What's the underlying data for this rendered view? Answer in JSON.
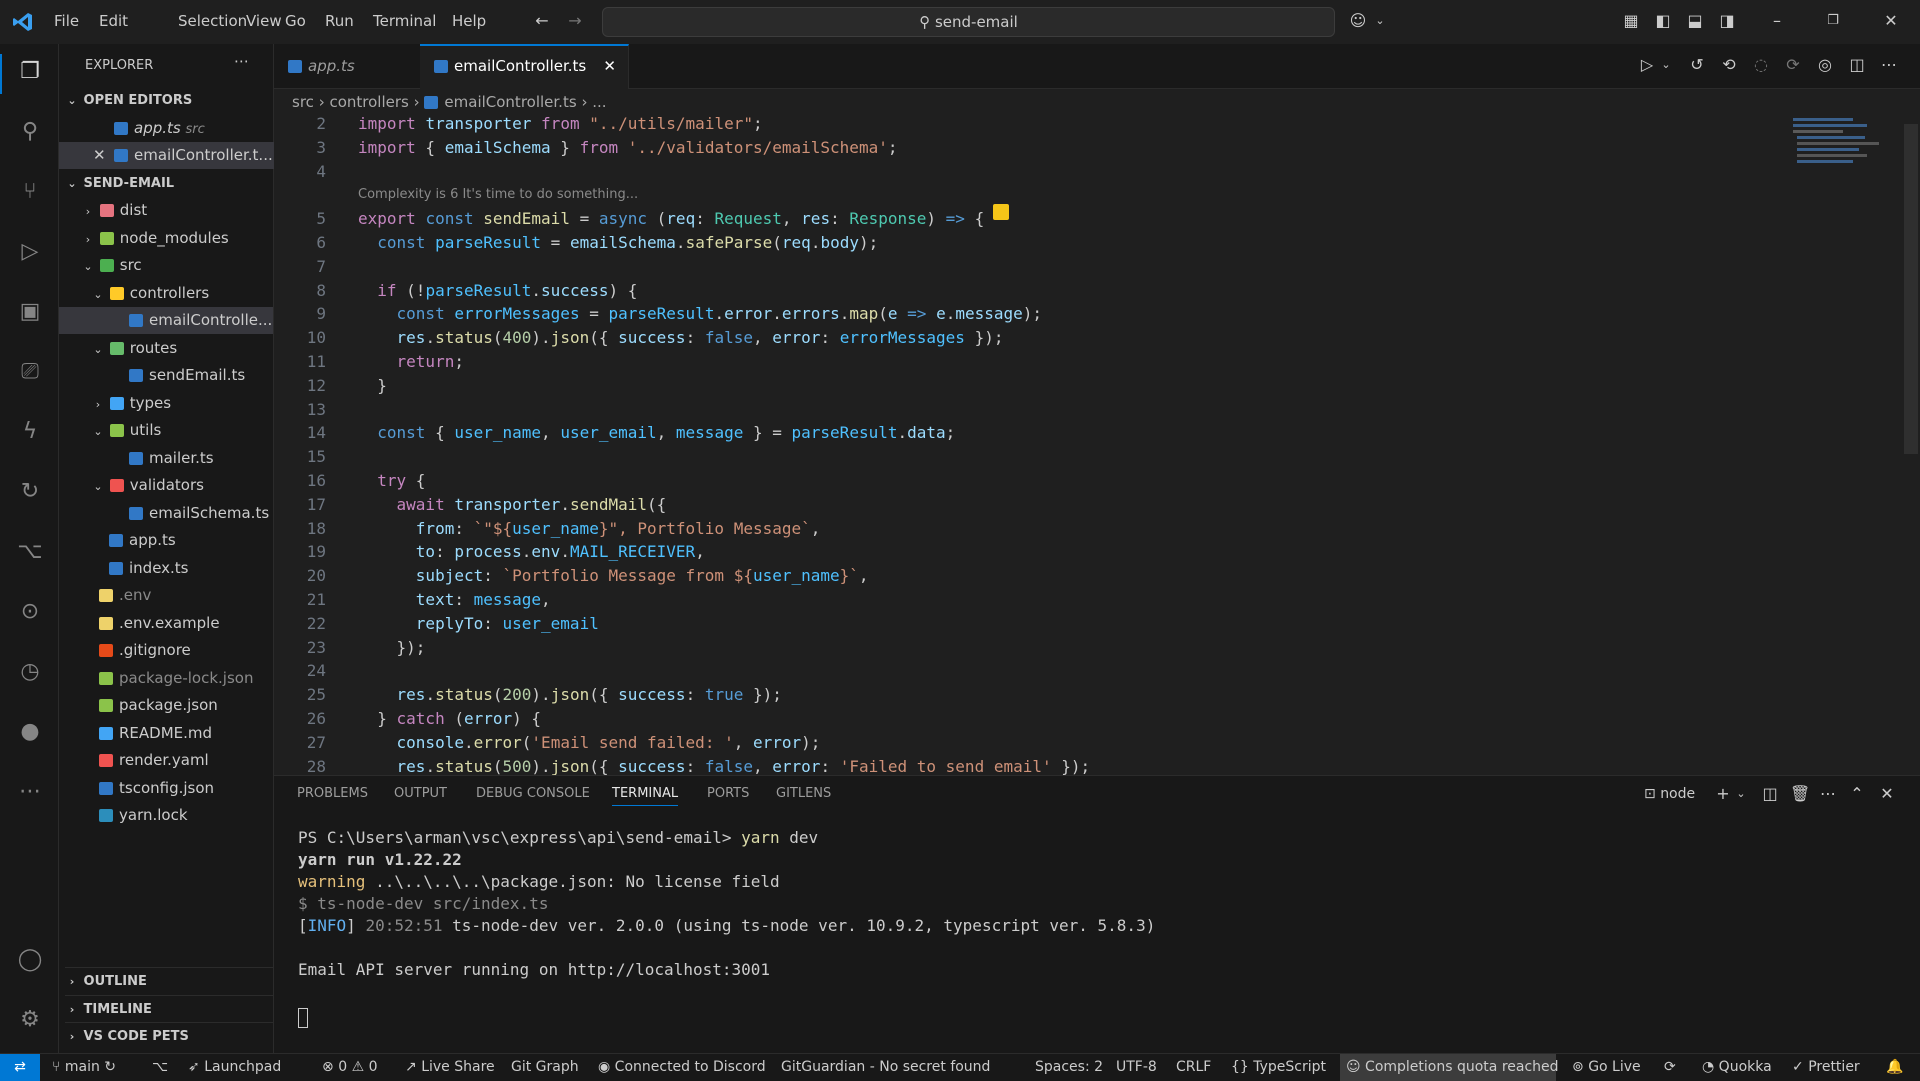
{
  "menu": [
    "File",
    "Edit",
    "Selection",
    "View",
    "Go",
    "Run",
    "Terminal",
    "Help"
  ],
  "search": {
    "text": "send-email"
  },
  "explorer": {
    "title": "EXPLORER",
    "open_editors_label": "OPEN EDITORS",
    "open_editors": [
      {
        "name": "app.ts",
        "path": "src"
      },
      {
        "name": "emailController.t..."
      }
    ],
    "project_label": "SEND-EMAIL",
    "tree": [
      {
        "name": "dist",
        "level": 1,
        "kind": "folder",
        "color": "#e5737f",
        "chevron": "›"
      },
      {
        "name": "node_modules",
        "level": 1,
        "kind": "folder",
        "color": "#8bc34a",
        "chevron": "›"
      },
      {
        "name": "src",
        "level": 1,
        "kind": "folder",
        "color": "#4caf50",
        "chevron": "⌄"
      },
      {
        "name": "controllers",
        "level": 2,
        "kind": "folder",
        "color": "#ffca28",
        "chevron": "⌄"
      },
      {
        "name": "emailControlle...",
        "level": 3,
        "kind": "ts",
        "color": "#3178c6",
        "selected": true
      },
      {
        "name": "routes",
        "level": 2,
        "kind": "folder",
        "color": "#66bb6a",
        "chevron": "⌄"
      },
      {
        "name": "sendEmail.ts",
        "level": 3,
        "kind": "ts",
        "color": "#3178c6"
      },
      {
        "name": "types",
        "level": 2,
        "kind": "folder",
        "color": "#42a5f5",
        "chevron": "›"
      },
      {
        "name": "utils",
        "level": 2,
        "kind": "folder",
        "color": "#8bc34a",
        "chevron": "⌄"
      },
      {
        "name": "mailer.ts",
        "level": 3,
        "kind": "ts",
        "color": "#3178c6"
      },
      {
        "name": "validators",
        "level": 2,
        "kind": "folder",
        "color": "#ef5350",
        "chevron": "⌄"
      },
      {
        "name": "emailSchema.ts",
        "level": 3,
        "kind": "ts",
        "color": "#3178c6"
      },
      {
        "name": "app.ts",
        "level": 2,
        "kind": "ts",
        "color": "#3178c6"
      },
      {
        "name": "index.ts",
        "level": 2,
        "kind": "ts",
        "color": "#3178c6"
      },
      {
        "name": ".env",
        "level": 1,
        "kind": "file",
        "color": "#eed26a",
        "dim": true
      },
      {
        "name": ".env.example",
        "level": 1,
        "kind": "file",
        "color": "#eed26a"
      },
      {
        "name": ".gitignore",
        "level": 1,
        "kind": "file",
        "color": "#e64a19"
      },
      {
        "name": "package-lock.json",
        "level": 1,
        "kind": "file",
        "color": "#8bc34a",
        "dim": true
      },
      {
        "name": "package.json",
        "level": 1,
        "kind": "file",
        "color": "#8bc34a"
      },
      {
        "name": "README.md",
        "level": 1,
        "kind": "file",
        "color": "#42a5f5"
      },
      {
        "name": "render.yaml",
        "level": 1,
        "kind": "file",
        "color": "#ef5350"
      },
      {
        "name": "tsconfig.json",
        "level": 1,
        "kind": "file",
        "color": "#3178c6"
      },
      {
        "name": "yarn.lock",
        "level": 1,
        "kind": "file",
        "color": "#2c8ebb"
      }
    ],
    "bottom_sections": [
      "OUTLINE",
      "TIMELINE",
      "VS CODE PETS"
    ]
  },
  "tabs": [
    {
      "label": "app.ts",
      "active": false
    },
    {
      "label": "emailController.ts",
      "active": true
    }
  ],
  "breadcrumb": [
    "src",
    "controllers",
    "emailController.ts",
    "..."
  ],
  "editor": {
    "codelens": "Complexity is 6 It's time to do something...",
    "lines": [
      {
        "n": "2",
        "html": "<span class='ctl'>import</span> <span class='var'>transporter</span> <span class='ctl'>from</span> <span class='str'>\"../utils/mailer\"</span>;"
      },
      {
        "n": "3",
        "html": "<span class='ctl'>import</span> { <span class='var'>emailSchema</span> } <span class='ctl'>from</span> <span class='str'>'../validators/emailSchema'</span>;"
      },
      {
        "n": "4",
        "html": ""
      },
      {
        "n": "5",
        "html": "<span class='ctl'>export</span> <span class='kw'>const</span> <span class='fn'>sendEmail</span> = <span class='kw'>async</span> (<span class='var'>req</span>: <span class='ty'>Request</span>, <span class='var'>res</span>: <span class='ty'>Response</span>) <span class='kw'>=&gt;</span> {"
      },
      {
        "n": "6",
        "html": "  <span class='kw'>const</span> <span class='cst'>parseResult</span> = <span class='var'>emailSchema</span>.<span class='fn'>safeParse</span>(<span class='var'>req</span>.<span class='var'>body</span>);"
      },
      {
        "n": "7",
        "html": ""
      },
      {
        "n": "8",
        "html": "  <span class='ctl'>if</span> (!<span class='cst'>parseResult</span>.<span class='var'>success</span>) {"
      },
      {
        "n": "9",
        "html": "    <span class='kw'>const</span> <span class='cst'>errorMessages</span> = <span class='cst'>parseResult</span>.<span class='var'>error</span>.<span class='var'>errors</span>.<span class='fn'>map</span>(<span class='var'>e</span> <span class='kw'>=&gt;</span> <span class='var'>e</span>.<span class='var'>message</span>);"
      },
      {
        "n": "10",
        "html": "    <span class='var'>res</span>.<span class='fn'>status</span>(<span class='num'>400</span>).<span class='fn'>json</span>({ <span class='var'>success</span>: <span class='kw'>false</span>, <span class='var'>error</span>: <span class='cst'>errorMessages</span> });"
      },
      {
        "n": "11",
        "html": "    <span class='ctl'>return</span>;"
      },
      {
        "n": "12",
        "html": "  }"
      },
      {
        "n": "13",
        "html": ""
      },
      {
        "n": "14",
        "html": "  <span class='kw'>const</span> { <span class='cst'>user_name</span>, <span class='cst'>user_email</span>, <span class='cst'>message</span> } = <span class='cst'>parseResult</span>.<span class='var'>data</span>;"
      },
      {
        "n": "15",
        "html": ""
      },
      {
        "n": "16",
        "html": "  <span class='ctl'>try</span> {"
      },
      {
        "n": "17",
        "html": "    <span class='ctl'>await</span> <span class='var'>transporter</span>.<span class='fn'>sendMail</span>({"
      },
      {
        "n": "18",
        "html": "      <span class='var'>from</span>: <span class='str'>`\"${</span><span class='cst'>user_name</span><span class='str'>}\", Portfolio Message`</span>,"
      },
      {
        "n": "19",
        "html": "      <span class='var'>to</span>: <span class='var'>process</span>.<span class='var'>env</span>.<span class='cst'>MAIL_RECEIVER</span>,"
      },
      {
        "n": "20",
        "html": "      <span class='var'>subject</span>: <span class='str'>`Portfolio Message from ${</span><span class='cst'>user_name</span><span class='str'>}`</span>,"
      },
      {
        "n": "21",
        "html": "      <span class='var'>text</span>: <span class='cst'>message</span>,"
      },
      {
        "n": "22",
        "html": "      <span class='var'>replyTo</span>: <span class='cst'>user_email</span>"
      },
      {
        "n": "23",
        "html": "    });"
      },
      {
        "n": "24",
        "html": ""
      },
      {
        "n": "25",
        "html": "    <span class='var'>res</span>.<span class='fn'>status</span>(<span class='num'>200</span>).<span class='fn'>json</span>({ <span class='var'>success</span>: <span class='kw'>true</span> });"
      },
      {
        "n": "26",
        "html": "  } <span class='ctl'>catch</span> (<span class='var'>error</span>) {"
      },
      {
        "n": "27",
        "html": "    <span class='var'>console</span>.<span class='fn'>error</span>(<span class='str'>'Email send failed: '</span>, <span class='var'>error</span>);"
      },
      {
        "n": "28",
        "html": "    <span class='var'>res</span>.<span class='fn'>status</span>(<span class='num'>500</span>).<span class='fn'>json</span>({ <span class='var'>success</span>: <span class='kw'>false</span>, <span class='var'>error</span>: <span class='str'>'Failed to send email'</span> });"
      }
    ]
  },
  "panel": {
    "tabs": [
      "PROBLEMS",
      "OUTPUT",
      "DEBUG CONSOLE",
      "TERMINAL",
      "PORTS",
      "GITLENS"
    ],
    "active_tab": "TERMINAL",
    "shell": "node",
    "terminal": [
      {
        "html": "PS C:\\Users\\arman\\vsc\\express\\api\\send-email&gt; <span style='color:#dcdcaa'>yarn</span> dev"
      },
      {
        "html": "<b>yarn run v1.22.22</b>"
      },
      {
        "html": "<span style='color:#e5c07b'>warning</span> ..\\..\\..\\..\\package.json: No license field"
      },
      {
        "html": "<span style='color:#8a8a8a'>$ ts-node-dev src/index.ts</span>"
      },
      {
        "html": "[<span style='color:#61afef'>INFO</span>] <span style='color:#8a8a8a'>20:52:51</span> ts-node-dev ver. 2.0.0 (using ts-node ver. 10.9.2, typescript ver. 5.8.3)"
      },
      {
        "html": ""
      },
      {
        "html": "Email API server running on http://localhost:3001"
      }
    ]
  },
  "status": {
    "branch": "main",
    "launchpad": "Launchpad",
    "problems_errors": "0",
    "problems_warnings": "0",
    "liveshare": "Live Share",
    "gitgraph": "Git Graph",
    "discord": "Connected to Discord",
    "gitguardian": "GitGuardian - No secret found",
    "spaces": "Spaces: 2",
    "encoding": "UTF-8",
    "eol": "CRLF",
    "language": "TypeScript",
    "completions": "Completions quota reached",
    "golive": "Go Live",
    "quokka": "Quokka",
    "prettier": "Prettier"
  }
}
